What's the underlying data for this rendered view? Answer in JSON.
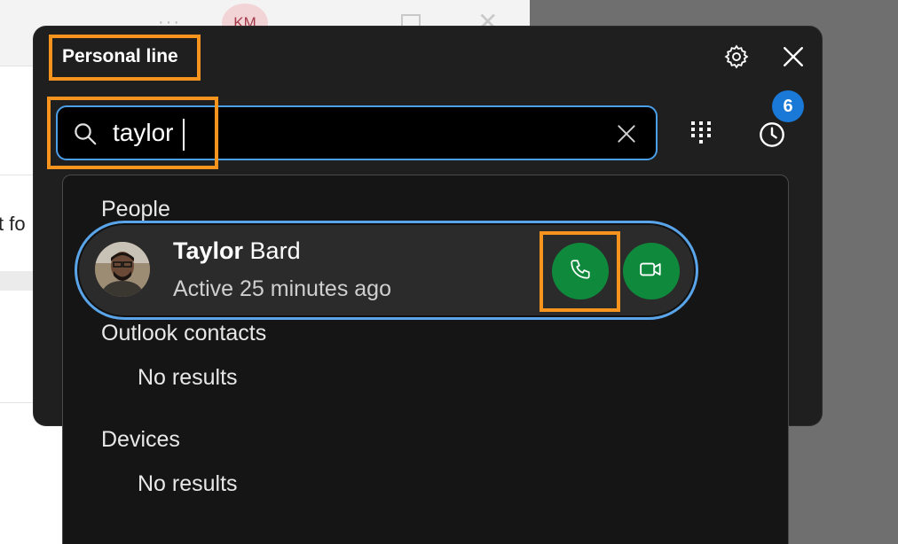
{
  "background_app": {
    "avatar_initials": "KM",
    "partial_text": "t fo"
  },
  "header": {
    "title": "Personal line",
    "settings_icon": "gear-icon",
    "close_icon": "close-icon"
  },
  "search": {
    "value": "taylor",
    "search_icon": "search-icon",
    "clear_icon": "clear-icon"
  },
  "toolbar": {
    "dialpad_icon": "dialpad-icon",
    "history_icon": "clock-icon",
    "history_badge": "6"
  },
  "results": {
    "people_header": "People",
    "person": {
      "first_name": "Taylor",
      "last_name": "Bard",
      "status": "Active 25 minutes ago",
      "audio_call_icon": "phone-icon",
      "video_call_icon": "video-icon"
    },
    "outlook_header": "Outlook contacts",
    "outlook_empty": "No results",
    "devices_header": "Devices",
    "devices_empty": "No results"
  },
  "colors": {
    "highlight": "#f7941d",
    "accent_blue": "#4a9fe8",
    "call_green": "#0f8a3c",
    "badge_blue": "#1a78d6",
    "panel_bg": "#1f1f1f"
  }
}
